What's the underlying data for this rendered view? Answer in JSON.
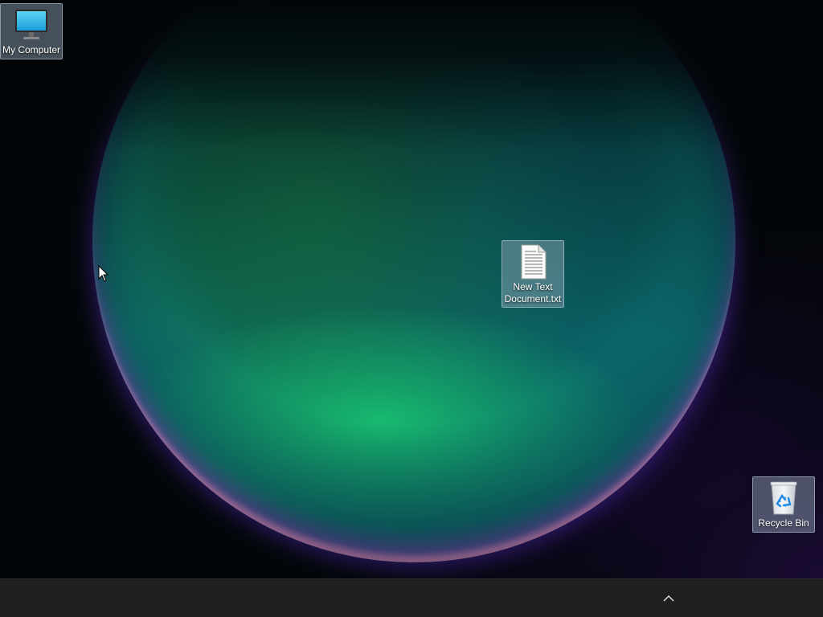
{
  "desktop": {
    "icons": [
      {
        "label": "My Computer",
        "icon": "monitor-icon"
      },
      {
        "label": "New Text\nDocument.txt",
        "icon": "text-document-icon"
      },
      {
        "label": "Recycle Bin",
        "icon": "recycle-bin-icon"
      }
    ]
  },
  "taskbar": {
    "tray_icon": "chevron-up-icon"
  },
  "colors": {
    "taskbar": "#1f1f1f",
    "selection": "#96aabe",
    "orb_rim": "#ffaae6"
  }
}
